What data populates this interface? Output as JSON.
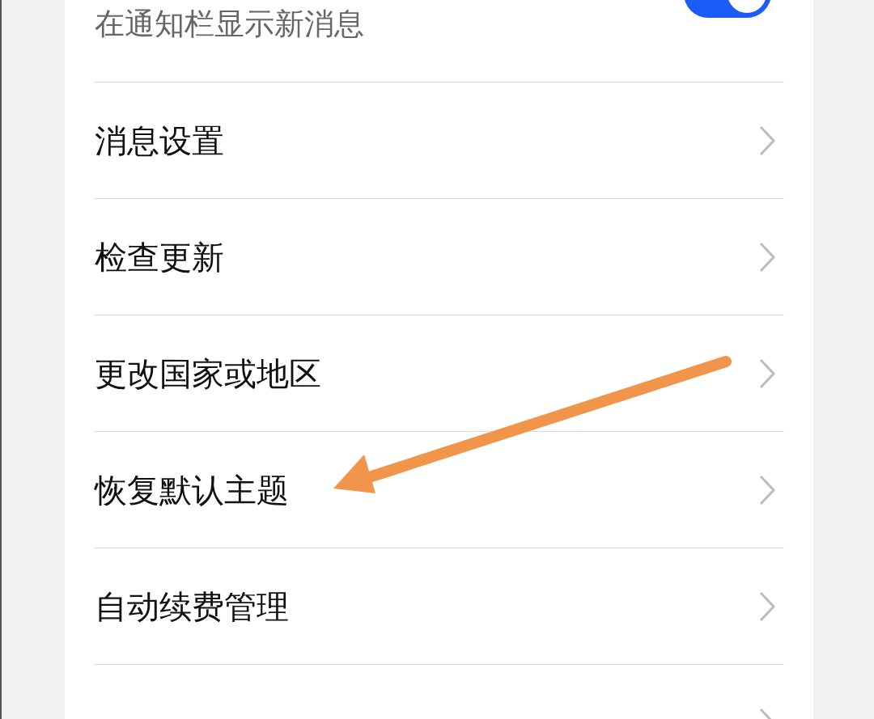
{
  "notification": {
    "subtitle": "在通知栏显示新消息",
    "on": true
  },
  "items": [
    {
      "label": "消息设置"
    },
    {
      "label": "检查更新"
    },
    {
      "label": "更改国家或地区"
    },
    {
      "label": "恢复默认主题"
    },
    {
      "label": "自动续费管理"
    }
  ]
}
